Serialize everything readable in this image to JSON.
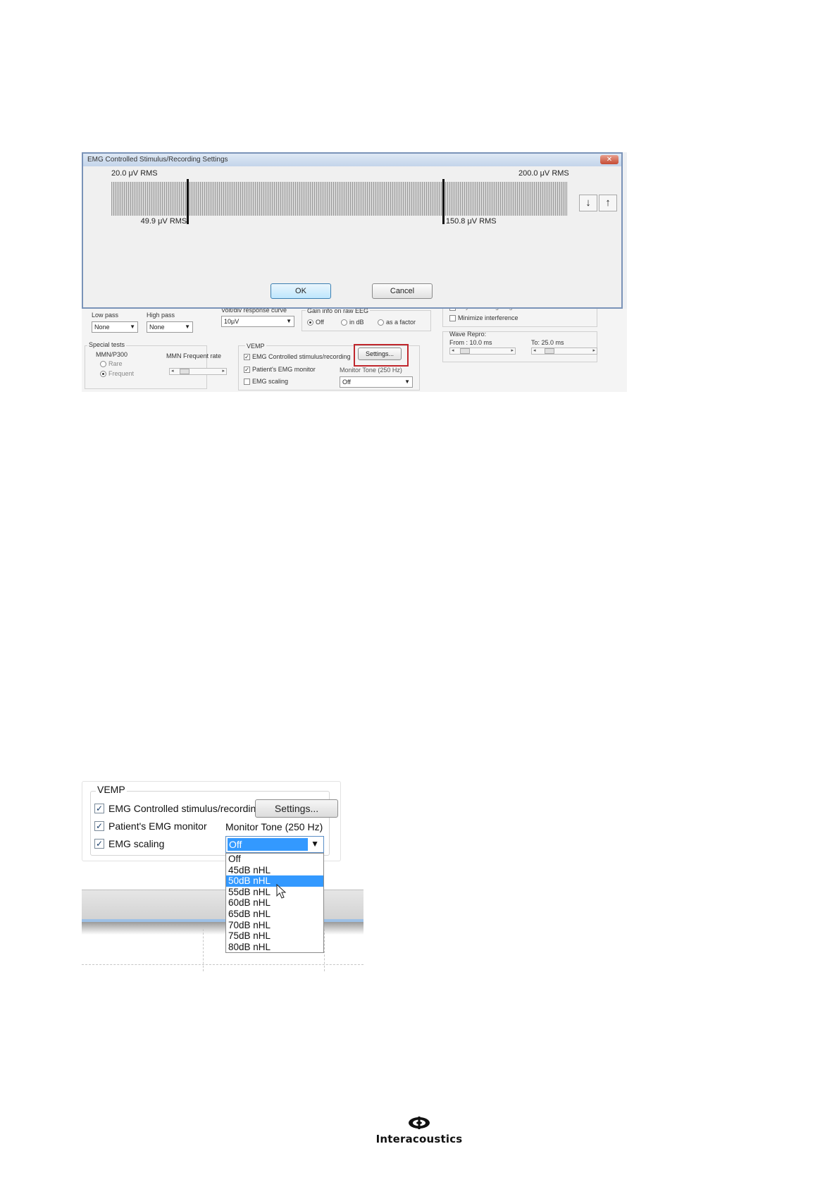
{
  "screenshot1": {
    "dialog_title": "EMG Controlled Stimulus/Recording Settings",
    "close_glyph": "✕",
    "scale_min_label": "20.0 μV RMS",
    "scale_max_label": "200.0 μV RMS",
    "lower_marker_label": "49.9 μV RMS",
    "upper_marker_label": "150.8 μV RMS",
    "lower_marker_value": 49.9,
    "upper_marker_value": 150.8,
    "scale_min": 20.0,
    "scale_max": 200.0,
    "down_arrow": "↓",
    "up_arrow": "↑",
    "ok_label": "OK",
    "cancel_label": "Cancel",
    "background": {
      "low_pass_label": "Low pass",
      "low_pass_value": "None",
      "high_pass_label": "High pass",
      "high_pass_value": "None",
      "response_curve_label": "Volt/div response curve",
      "response_curve_value": "10μV",
      "gain_info_label": "Gain info on raw EEG",
      "gain_options": [
        "Off",
        "in dB",
        "as a factor"
      ],
      "gain_selected": "Off",
      "bayesian_label": "Bayesian weighting",
      "minimize_label": "Minimize interference",
      "wave_repro_label": "Wave Repro:",
      "wave_from_label": "From : 10.0 ms",
      "wave_to_label": "To:  25.0 ms",
      "special_tests_label": "Special tests",
      "mmn_label": "MMN/P300",
      "mmn_rare": "Rare",
      "mmn_frequent": "Frequent",
      "mmn_rate_label": "MMN Frequent rate",
      "vemp_label": "VEMP",
      "emg_controlled_label": "EMG Controlled stimulus/recording",
      "settings_label": "Settings...",
      "patients_emg_label": "Patient's EMG monitor",
      "monitor_tone_label": "Monitor Tone (250 Hz)",
      "monitor_tone_value": "Off",
      "emg_scaling_label": "EMG scaling",
      "check_glyph": "✓",
      "arrow_down": "▼",
      "left_arrow": "◂",
      "right_arrow": "▸"
    }
  },
  "screenshot2": {
    "vemp_label": "VEMP",
    "check_glyph": "✓",
    "emg_controlled_label": "EMG Controlled stimulus/recording",
    "settings_label": "Settings...",
    "patients_emg_label": "Patient's EMG monitor",
    "monitor_tone_label": "Monitor Tone (250 Hz)",
    "emg_scaling_label": "EMG scaling",
    "selected_value": "Off",
    "dropdown_arrow": "▼",
    "options": [
      "Off",
      "45dB nHL",
      "50dB nHL",
      "55dB nHL",
      "60dB nHL",
      "65dB nHL",
      "70dB nHL",
      "75dB nHL",
      "80dB nHL"
    ],
    "highlighted_option": "50dB nHL"
  },
  "logo": {
    "text": "Interacoustics"
  }
}
